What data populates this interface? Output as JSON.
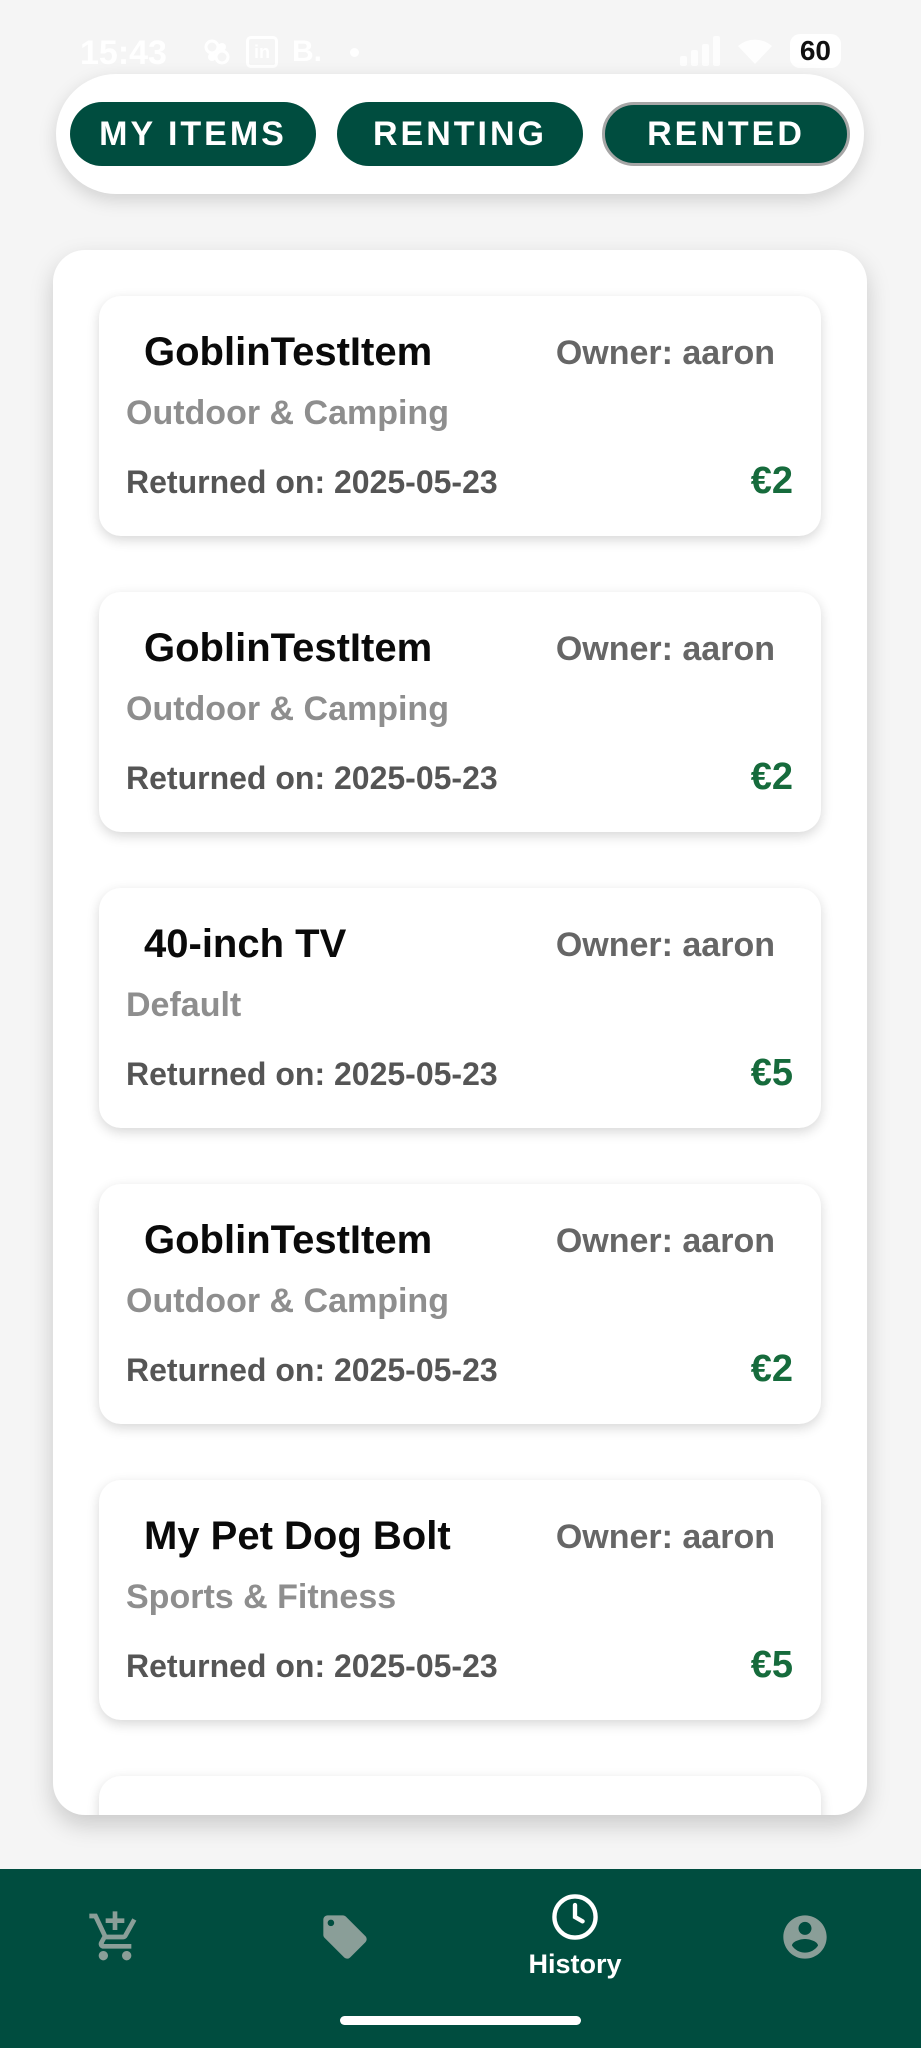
{
  "status_bar": {
    "time": "15:43",
    "battery": "60",
    "icons": [
      "pinwheel-icon",
      "linkedin-icon",
      "b-icon",
      "notification-dot-icon",
      "signal-icon",
      "wifi-icon",
      "battery-icon"
    ],
    "b_label": "B."
  },
  "tabs": [
    {
      "label": "MY ITEMS",
      "active": false
    },
    {
      "label": "RENTING",
      "active": false
    },
    {
      "label": "RENTED",
      "active": true
    }
  ],
  "rentals": [
    {
      "name": "GoblinTestItem",
      "owner": "Owner: aaron",
      "category": "Outdoor & Camping",
      "returned": "Returned on: 2025-05-23",
      "price": "€2"
    },
    {
      "name": "GoblinTestItem",
      "owner": "Owner: aaron",
      "category": "Outdoor & Camping",
      "returned": "Returned on: 2025-05-23",
      "price": "€2"
    },
    {
      "name": "40-inch TV",
      "owner": "Owner: aaron",
      "category": "Default",
      "returned": "Returned on: 2025-05-23",
      "price": "€5"
    },
    {
      "name": "GoblinTestItem",
      "owner": "Owner: aaron",
      "category": "Outdoor & Camping",
      "returned": "Returned on: 2025-05-23",
      "price": "€2"
    },
    {
      "name": "My Pet Dog Bolt",
      "owner": "Owner: aaron",
      "category": "Sports & Fitness",
      "returned": "Returned on: 2025-05-23",
      "price": "€5"
    }
  ],
  "bottom_nav": [
    {
      "icon": "add-cart-icon",
      "label": "",
      "active": false
    },
    {
      "icon": "tag-icon",
      "label": "",
      "active": false
    },
    {
      "icon": "clock-icon",
      "label": "History",
      "active": true
    },
    {
      "icon": "account-icon",
      "label": "",
      "active": false
    }
  ],
  "colors": {
    "brand": "#004d3f",
    "price": "#166b3c",
    "inactive_icon": "#8a9e98",
    "active_icon": "#ffffff"
  }
}
